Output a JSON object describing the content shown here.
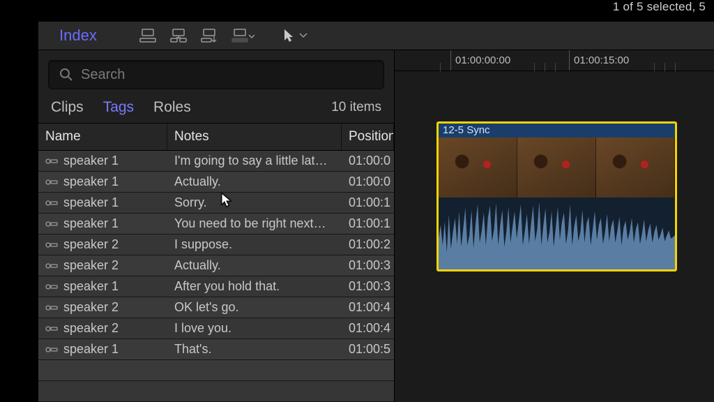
{
  "status": {
    "selection": "1 of 5 selected, 5"
  },
  "toolbar": {
    "index": "Index"
  },
  "search": {
    "placeholder": "Search"
  },
  "tabs": {
    "clips": "Clips",
    "tags": "Tags",
    "roles": "Roles"
  },
  "item_count": "10 items",
  "columns": {
    "name": "Name",
    "notes": "Notes",
    "position": "Position"
  },
  "rows": [
    {
      "name": "speaker 1",
      "notes": "I'm going to say a little lat…",
      "pos": "01:00:0"
    },
    {
      "name": "speaker 1",
      "notes": "Actually.",
      "pos": "01:00:0"
    },
    {
      "name": "speaker 1",
      "notes": "Sorry.",
      "pos": "01:00:1"
    },
    {
      "name": "speaker 1",
      "notes": "You need to be right next…",
      "pos": "01:00:1"
    },
    {
      "name": "speaker 2",
      "notes": "I suppose.",
      "pos": "01:00:2"
    },
    {
      "name": "speaker 2",
      "notes": "Actually.",
      "pos": "01:00:3"
    },
    {
      "name": "speaker 1",
      "notes": "After you hold that.",
      "pos": "01:00:3"
    },
    {
      "name": "speaker 2",
      "notes": "OK let's go.",
      "pos": "01:00:4"
    },
    {
      "name": "speaker 2",
      "notes": "I love you.",
      "pos": "01:00:4"
    },
    {
      "name": "speaker 1",
      "notes": "That's.",
      "pos": "01:00:5"
    }
  ],
  "ruler": {
    "t0": "01:00:00:00",
    "t1": "01:00:15:00"
  },
  "clip": {
    "label": "12-5 Sync"
  }
}
